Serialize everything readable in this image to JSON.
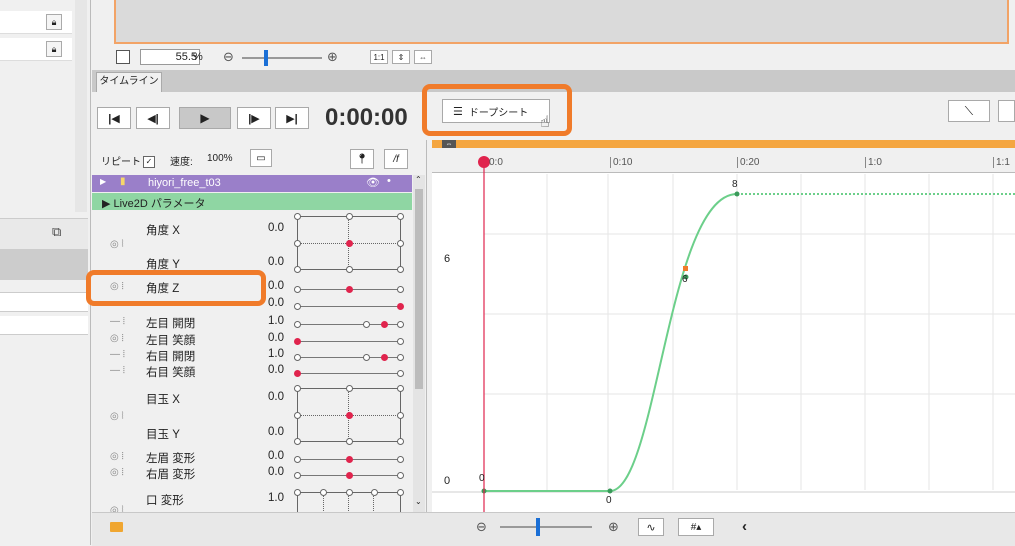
{
  "left_panel": {
    "lock_icons": [
      "lock-icon",
      "lock-icon"
    ],
    "badge": "⧉"
  },
  "zoom_bar": {
    "zoom_value": "55.5",
    "zoom_unit": "%",
    "fit_label": "1:1"
  },
  "timeline": {
    "tab_label": "タイムライン",
    "timecode": "0:00:00",
    "dopesheet_label": "ドープシート",
    "repeat_label": "リピート",
    "speed_label": "速度:",
    "speed_value": "100%",
    "clip_name": "hiyori_free_t03",
    "group_name": "▶ Live2D パラメータ",
    "ruler": [
      "0:0",
      "0:10",
      "0:20",
      "1:0",
      "1:1"
    ],
    "yaxis": [
      "6",
      "0"
    ],
    "curve_labels": {
      "start": "0",
      "mid_low": "0",
      "mid": "6",
      "top": "8"
    }
  },
  "params": [
    {
      "name": "角度 X",
      "value": "0.0"
    },
    {
      "name": "角度 Y",
      "value": "0.0"
    },
    {
      "name": "角度 Z",
      "value": "0.0"
    },
    {
      "name": "",
      "value": "0.0"
    },
    {
      "name": "左目 開閉",
      "value": "1.0"
    },
    {
      "name": "左目 笑顔",
      "value": "0.0"
    },
    {
      "name": "右目 開閉",
      "value": "1.0"
    },
    {
      "name": "右目 笑顔",
      "value": "0.0"
    },
    {
      "name": "目玉 X",
      "value": "0.0"
    },
    {
      "name": "目玉 Y",
      "value": "0.0"
    },
    {
      "name": "左眉 変形",
      "value": "0.0"
    },
    {
      "name": "右眉 変形",
      "value": "0.0"
    },
    {
      "name": "口 変形",
      "value": "1.0"
    }
  ],
  "colors": {
    "accent_orange": "#f07b2a",
    "playhead": "#e0244d",
    "curve": "#6ccf8a",
    "clip_purple": "#9a7fc9",
    "group_green": "#8fd6a3"
  }
}
